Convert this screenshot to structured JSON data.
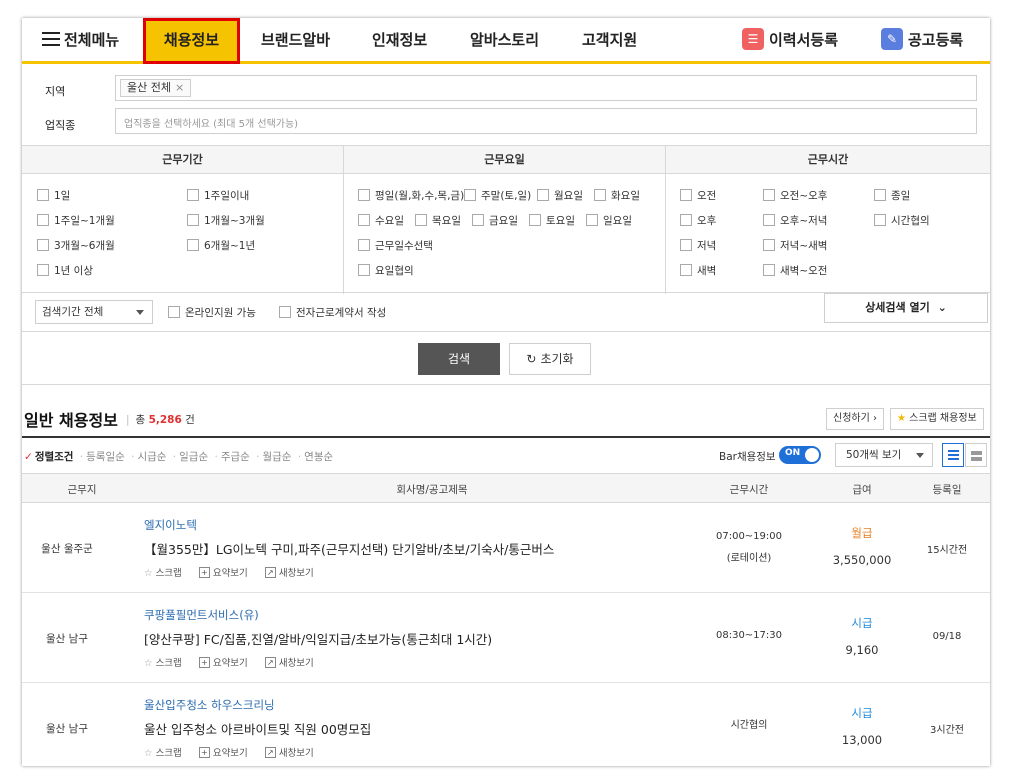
{
  "nav": {
    "menu": "전체메뉴",
    "items": [
      "채용정보",
      "브랜드알바",
      "인재정보",
      "알바스토리",
      "고객지원"
    ],
    "resume": "이력서등록",
    "post": "공고등록",
    "colors": {
      "accent": "#f5c300",
      "highlight_border": "#e00000"
    }
  },
  "filters": {
    "region_label": "지역",
    "region_chip": "울산 전체",
    "job_label": "업직종",
    "job_placeholder": "업직종을 선택하세요 (최대 5개 선택가능)"
  },
  "period": {
    "title": "근무기간",
    "options": [
      "1일",
      "1주일이내",
      "1주일~1개월",
      "1개월~3개월",
      "3개월~6개월",
      "6개월~1년",
      "1년 이상"
    ]
  },
  "days": {
    "title": "근무요일",
    "options": [
      "평일(월,화,수,목,금)",
      "주말(토,일)",
      "월요일",
      "화요일",
      "수요일",
      "목요일",
      "금요일",
      "토요일",
      "일요일",
      "근무일수선택",
      "요일협의"
    ]
  },
  "hours": {
    "title": "근무시간",
    "options": [
      "오전",
      "오전~오후",
      "종일",
      "오후",
      "오후~저녁",
      "시간협의",
      "저녁",
      "저녁~새벽",
      "새벽",
      "새벽~오전"
    ]
  },
  "options_bar": {
    "period_select": "검색기간 전체",
    "online": "온라인지원 가능",
    "contract": "전자근로계약서 작성",
    "detail": "상세검색 열기"
  },
  "actions": {
    "search": "검색",
    "reset": "초기화"
  },
  "results": {
    "title": "일반 채용정보",
    "count_prefix": "총",
    "count": "5,286",
    "count_suffix": "건",
    "apply_btn": "신청하기",
    "scrap_btn": "스크랩 채용정보",
    "sort_active": "정렬조건",
    "sorts": [
      "등록일순",
      "시급순",
      "일급순",
      "주급순",
      "월급순",
      "연봉순"
    ],
    "bar_label": "Bar채용정보",
    "toggle": "ON",
    "per_page": "50개씩 보기"
  },
  "table": {
    "headers": [
      "근무지",
      "회사명/공고제목",
      "근무시간",
      "급여",
      "등록일"
    ],
    "action_labels": {
      "scrap": "스크랩",
      "summary": "요약보기",
      "newwin": "새창보기"
    },
    "rows": [
      {
        "location": "울산 울주군",
        "company": "엘지이노텍",
        "title": "【월355만】LG이노텍 구미,파주(근무지선택) 단기알바/초보/기숙사/통근버스",
        "time": "07:00~19:00",
        "time_note": "(로테이션)",
        "pay_type": "월급",
        "pay": "3,550,000",
        "date": "15시간전",
        "pay_color": "#e67e22"
      },
      {
        "location": "울산 남구",
        "company": "쿠팡풀필먼트서비스(유)",
        "title": "[양산쿠팡] FC/집품,진열/알바/익일지급/초보가능(통근최대 1시간)",
        "time": "08:30~17:30",
        "time_note": "",
        "pay_type": "시급",
        "pay": "9,160",
        "date": "09/18",
        "pay_color": "#1f8ad9"
      },
      {
        "location": "울산 남구",
        "company": "울산입주청소 하우스크리닝",
        "title": "울산 입주청소 아르바이트및 직원 00명모집",
        "time": "시간협의",
        "time_note": "",
        "pay_type": "시급",
        "pay": "13,000",
        "date": "3시간전",
        "pay_color": "#1f8ad9"
      }
    ]
  }
}
